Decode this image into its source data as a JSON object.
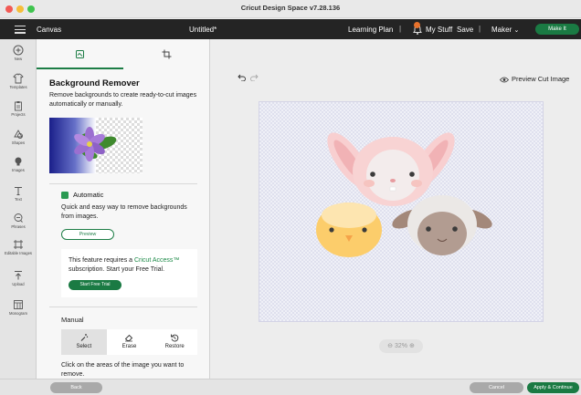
{
  "window": {
    "title": "Cricut Design Space  v7.28.136"
  },
  "header": {
    "canvas_label": "Canvas",
    "project_title": "Untitled*",
    "learning_plan": "Learning Plan",
    "separator": "|",
    "my_stuff": "My Stuff",
    "save": "Save",
    "machine": "Maker",
    "make_it": "Make It"
  },
  "toolbar": {
    "items": [
      {
        "label": "New",
        "icon": "plus-circle-icon"
      },
      {
        "label": "Templates",
        "icon": "shirt-icon"
      },
      {
        "label": "Projects",
        "icon": "clipboard-icon"
      },
      {
        "label": "Shapes",
        "icon": "shapes-icon"
      },
      {
        "label": "Images",
        "icon": "lightbulb-icon"
      },
      {
        "label": "Text",
        "icon": "text-icon"
      },
      {
        "label": "Phrases",
        "icon": "speech-bubble-icon"
      },
      {
        "label": "Editable Images",
        "icon": "editable-images-icon"
      },
      {
        "label": "Upload",
        "icon": "upload-icon"
      },
      {
        "label": "Monogram",
        "icon": "monogram-icon"
      }
    ]
  },
  "panel": {
    "title": "Background Remover",
    "description": "Remove backgrounds to create ready-to-cut images automatically or manually.",
    "automatic": {
      "label": "Automatic",
      "description": "Quick and easy way to remove backgrounds from images.",
      "preview_button": "Preview"
    },
    "promo": {
      "text_before": "This feature requires a ",
      "link": "Cricut Access™",
      "text_after": " subscription. Start your Free Trial.",
      "button": "Start Free Trial"
    },
    "manual": {
      "label": "Manual",
      "tools": [
        "Select",
        "Erase",
        "Restore"
      ],
      "selected_tool": "Select",
      "description": "Click on the areas of the image you want to remove."
    }
  },
  "canvas": {
    "preview_cut": "Preview Cut Image",
    "zoom": "32%"
  },
  "bottom": {
    "back": "Back",
    "cancel": "Cancel",
    "apply": "Apply & Continue"
  },
  "colors": {
    "brand_green": "#1a7a43",
    "header_dark": "#242424",
    "bell_badge": "#e8722c"
  }
}
